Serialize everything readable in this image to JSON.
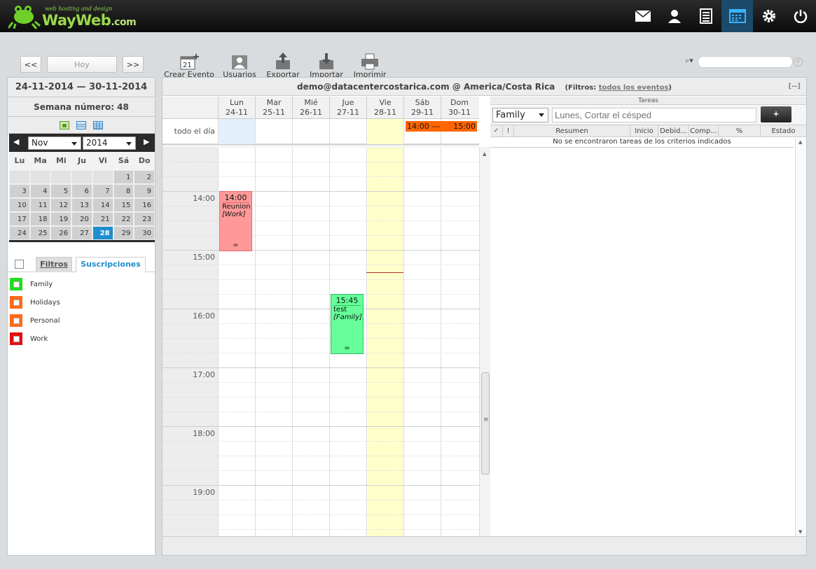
{
  "header": {
    "logo_tag": "web hosting and design",
    "logo_name": "WayWeb",
    "logo_suffix": ".com",
    "icons": [
      "mail-icon",
      "user-icon",
      "list-icon",
      "calendar-icon",
      "gear-icon",
      "power-icon"
    ]
  },
  "nav": {
    "prev": "<<",
    "today": "Hoy",
    "next": ">>"
  },
  "toolbar": {
    "create": "Crear Evento",
    "users": "Usuarios",
    "export": "Exportar",
    "import": "Importar",
    "print": "Imprimir",
    "create_icon_day": "21"
  },
  "sidebar": {
    "range": "24-11-2014 — 30-11-2014",
    "week": "Semana número: 48",
    "month_select": "Nov",
    "year_select": "2014",
    "dow": [
      "Lu",
      "Ma",
      "Mi",
      "Ju",
      "Vi",
      "Sá",
      "Do"
    ],
    "weeks": [
      [
        "",
        "",
        "",
        "",
        "",
        "1",
        "2"
      ],
      [
        "3",
        "4",
        "5",
        "6",
        "7",
        "8",
        "9"
      ],
      [
        "10",
        "11",
        "12",
        "13",
        "14",
        "15",
        "16"
      ],
      [
        "17",
        "18",
        "19",
        "20",
        "21",
        "22",
        "23"
      ],
      [
        "24",
        "25",
        "26",
        "27",
        "28",
        "29",
        "30"
      ]
    ],
    "today": "28",
    "tab_filters": "Filtros",
    "tab_subscriptions": "Suscripciones",
    "calendars": [
      {
        "name": "Family",
        "color": "#22dd22"
      },
      {
        "name": "Holidays",
        "color": "#ff6a1a"
      },
      {
        "name": "Personal",
        "color": "#ff6a1a"
      },
      {
        "name": "Work",
        "color": "#e21010"
      }
    ]
  },
  "main": {
    "title": "demo@datacentercostarica.com @ America/Costa Rica",
    "filter_label": "(Filtros:",
    "filter_link": "todos los eventos",
    "filter_close": ")",
    "collapse": "[--]",
    "days": [
      {
        "name": "Lun",
        "date": "24-11"
      },
      {
        "name": "Mar",
        "date": "25-11"
      },
      {
        "name": "Mié",
        "date": "26-11"
      },
      {
        "name": "Jue",
        "date": "27-11"
      },
      {
        "name": "Vie",
        "date": "28-11"
      },
      {
        "name": "Sáb",
        "date": "29-11"
      },
      {
        "name": "Dom",
        "date": "30-11"
      }
    ],
    "allday_label": "todo el día",
    "allday_event": {
      "start": "14:00",
      "sep": "---",
      "end": "15:00",
      "color": "#ff6600"
    },
    "times": [
      "14:00",
      "15:00",
      "16:00",
      "17:00",
      "18:00",
      "19:00"
    ],
    "events": [
      {
        "time": "14:00",
        "title": "Reunion",
        "category": "[Work]",
        "color": "#ff9999",
        "border": "#e06a6a",
        "handle": "="
      },
      {
        "time": "15:45",
        "title": "test",
        "category": "[Family]",
        "color": "#66ff99",
        "border": "#33bb66",
        "handle": "="
      }
    ]
  },
  "tasks": {
    "header": "Tareas",
    "calendar_select": "Family",
    "placeholder": "Lunes, Cortar el césped",
    "add": "+",
    "columns": [
      "!",
      "Resumen",
      "Inicio",
      "Debid...",
      "Comp...",
      "%",
      "Estado"
    ],
    "empty": "No se encontraron tareas de los criterios indicados"
  }
}
